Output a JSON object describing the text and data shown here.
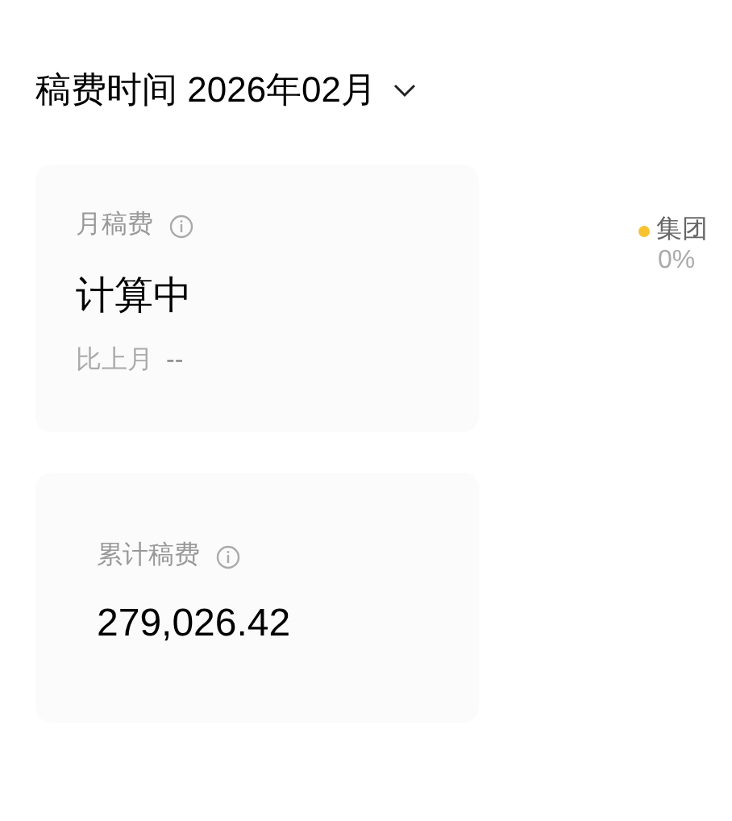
{
  "header": {
    "label": "稿费时间",
    "value": "2026年02月"
  },
  "cards": [
    {
      "kind": "monthly",
      "title": "月稿费",
      "value": "计算中",
      "compare_label": "比上月",
      "compare_value": "--"
    },
    {
      "kind": "total",
      "title": "累计稿费",
      "value": "279,026.42"
    }
  ],
  "legend": [
    {
      "label": "集团",
      "value": "0%",
      "color": "#f8c231"
    }
  ]
}
